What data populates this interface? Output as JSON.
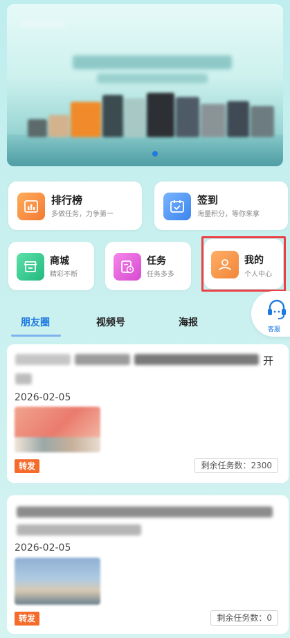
{
  "banner": {
    "pagination": "1"
  },
  "quick_actions": [
    {
      "title": "排行榜",
      "subtitle": "多做任务，力争第一",
      "icon": "ranking-chart-icon",
      "color": "#f38b3c"
    },
    {
      "title": "签到",
      "subtitle": "海量积分，等你来拿",
      "icon": "calendar-check-icon",
      "color": "#3c8cf0"
    },
    {
      "title": "商城",
      "subtitle": "精彩不断",
      "icon": "shop-icon",
      "color": "#2ec48a"
    },
    {
      "title": "任务",
      "subtitle": "任务多多",
      "icon": "task-clock-icon",
      "color": "#e25ad8"
    },
    {
      "title": "我的",
      "subtitle": "个人中心",
      "icon": "user-icon",
      "color": "#f4893a"
    }
  ],
  "service": {
    "label": "客服",
    "icon": "headset-icon"
  },
  "tabs": [
    {
      "label": "朋友圈",
      "active": true
    },
    {
      "label": "视频号",
      "active": false
    },
    {
      "label": "海报",
      "active": false
    }
  ],
  "posts": [
    {
      "text_fragment": "开",
      "date": "2026-02-05",
      "badge": "转发",
      "remaining_label": "剩余任务数：2300"
    },
    {
      "date": "2026-02-05",
      "badge": "转发",
      "remaining_label": "剩余任务数：0"
    }
  ],
  "colors": {
    "accent": "#1f7ae0",
    "highlight": "#ec4045",
    "badge": "#f46b2c"
  }
}
